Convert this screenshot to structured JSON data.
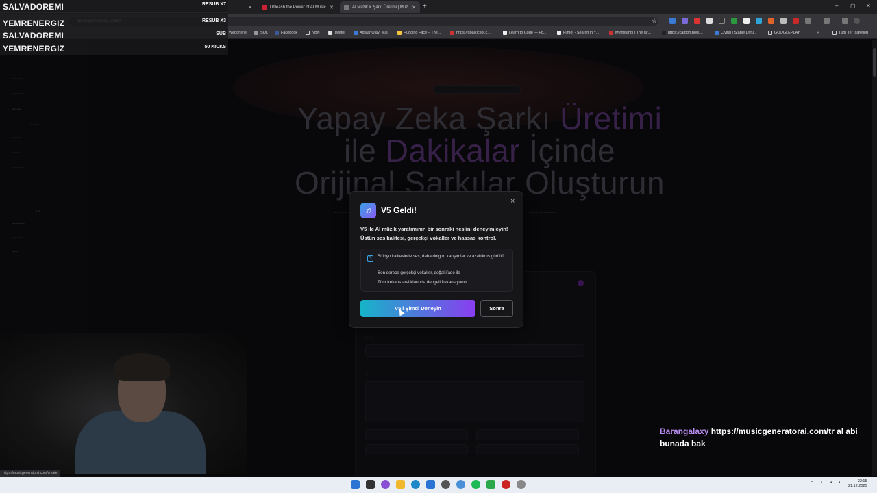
{
  "browser": {
    "tabs": [
      {
        "label": "Unleash the Power of AI Music",
        "active": false
      },
      {
        "label": "AI Müzik & Şarkı Üretimi | Müz",
        "active": true
      }
    ],
    "url": "musicgeneratorai.com/tr",
    "window_controls": [
      "–",
      "▢",
      "✕"
    ],
    "bookmarks": [
      "Webonline",
      "SQL",
      "Facebook",
      "NBN",
      "Twitter",
      "Agalar Olayı Mail",
      "Hugging Face – The...",
      "https://goalkicker.c...",
      "Learn to Code — Fo...",
      "Filmot - Search in Y...",
      "Myinstants | The lar...",
      "https://carbon.now....",
      "Civitai | Stable Diffu...",
      "GOOGLEPLAY",
      "Tüm Yer İşaretleri"
    ]
  },
  "modal": {
    "title": "V5 Geldi!",
    "description": "V5 ile AI müzik yaratımının bir sonraki neslini deneyimleyin! Üstün ses kalitesi, gerçekçi vokaller ve hassas kontrol.",
    "features": [
      "Stüdyo kalitesinde ses, daha dolgun karışımlar ve azaltılmış gürültü",
      "Son derece gerçekçi vokaller, doğal ifade ile",
      "Tüm frekans aralıklarında dengeli frekans yanıtı"
    ],
    "primary_button": "V5'i Şimdi Deneyin",
    "secondary_button": "Sonra",
    "close": "×"
  },
  "stream": {
    "alerts": [
      {
        "name": "SALVADOREMI",
        "event": "RESUB X7"
      },
      {
        "name": "YEMRENERGIZ",
        "event": "RESUB X3"
      },
      {
        "name": "SALVADOREMI",
        "event": "SUB"
      },
      {
        "name": "YEMRENERGIZ",
        "event": "50 KICKS"
      }
    ],
    "chat": {
      "user": "Barangalaxy",
      "message": "https://musicgeneratorai.com/tr al abi bunada bak"
    }
  },
  "status_url": "https://musicgeneratorai.com/create",
  "clock": {
    "time": "22:15",
    "date": "21.12.2025"
  }
}
